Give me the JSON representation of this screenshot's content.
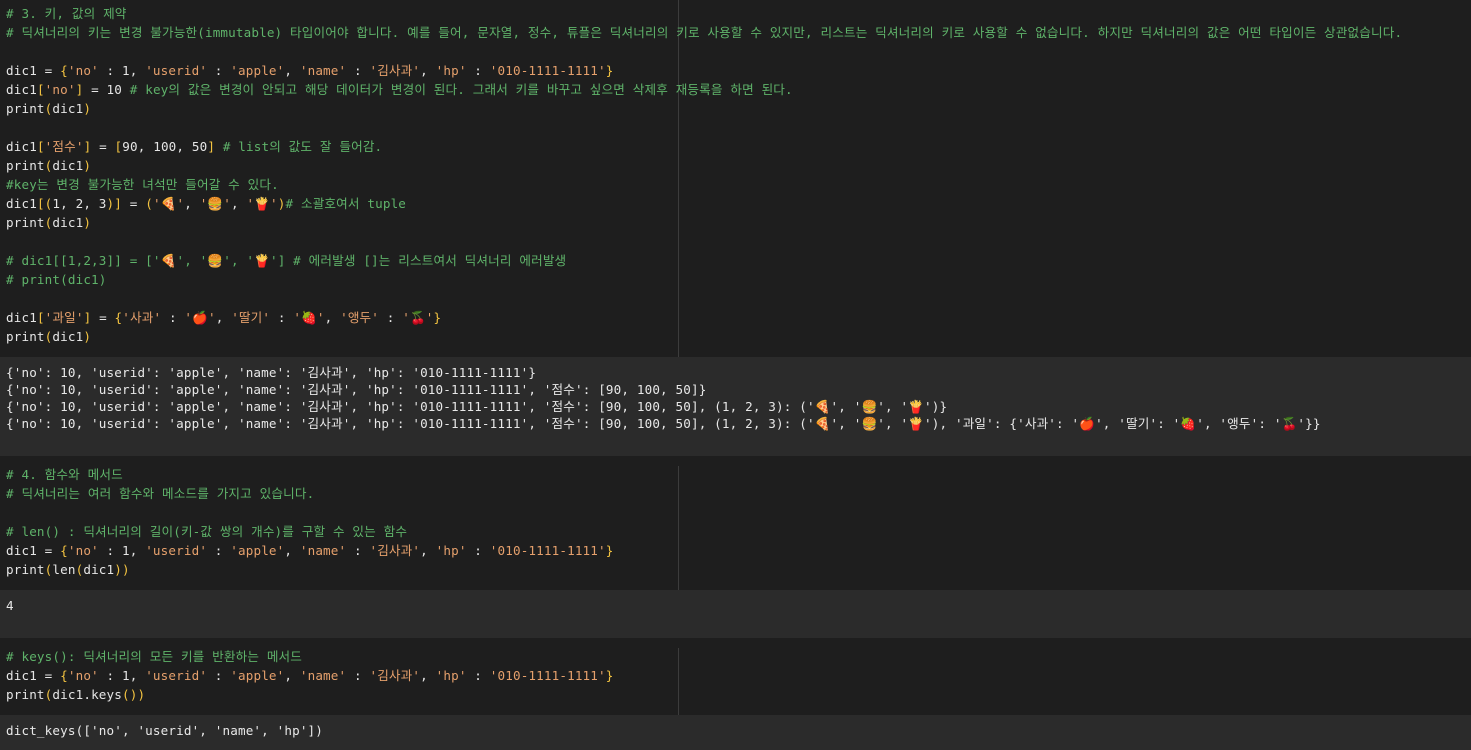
{
  "cells": [
    {
      "type": "code",
      "lines": [
        "# 3. 키, 값의 제약",
        "# 딕셔너리의 키는 변경 불가능한(immutable) 타입이어야 합니다. 예를 들어, 문자열, 정수, 튜플은 딕셔너리의 키로 사용할 수 있지만, 리스트는 딕셔너리의 키로 사용할 수 없습니다. 하지만 딕셔너리의 값은 어떤 타입이든 상관없습니다.",
        "",
        "dic1 = {'no' : 1, 'userid' : 'apple', 'name' : '김사과', 'hp' : '010-1111-1111'}",
        "dic1['no'] = 10 # key의 값은 변경이 안되고 해당 데이터가 변경이 된다. 그래서 키를 바꾸고 싶으면 삭제후 재등록을 하면 된다.",
        "print(dic1)",
        "",
        "dic1['점수'] = [90, 100, 50] # list의 값도 잘 들어감.",
        "print(dic1)",
        "#key는 변경 불가능한 녀석만 들어갈 수 있다.",
        "dic1[(1, 2, 3)] = ('🍕', '🍔', '🍟')# 소괄호여서 tuple",
        "print(dic1)",
        "",
        "# dic1[[1,2,3]] = ['🍕', '🍔', '🍟'] # 에러발생 []는 리스트여서 딕셔너리 에러발생",
        "# print(dic1)",
        "",
        "dic1['과일'] = {'사과' : '🍎', '딸기' : '🍓', '앵두' : '🍒'}",
        "print(dic1)"
      ]
    },
    {
      "type": "output",
      "lines": [
        "{'no': 10, 'userid': 'apple', 'name': '김사과', 'hp': '010-1111-1111'}",
        "{'no': 10, 'userid': 'apple', 'name': '김사과', 'hp': '010-1111-1111', '점수': [90, 100, 50]}",
        "{'no': 10, 'userid': 'apple', 'name': '김사과', 'hp': '010-1111-1111', '점수': [90, 100, 50], (1, 2, 3): ('🍕', '🍔', '🍟')}",
        "{'no': 10, 'userid': 'apple', 'name': '김사과', 'hp': '010-1111-1111', '점수': [90, 100, 50], (1, 2, 3): ('🍕', '🍔', '🍟'), '과일': {'사과': '🍎', '딸기': '🍓', '앵두': '🍒'}}"
      ]
    },
    {
      "type": "code",
      "lines": [
        "# 4. 함수와 메서드",
        "# 딕셔너리는 여러 함수와 메소드를 가지고 있습니다.",
        "",
        "# len() : 딕셔너리의 길이(키-값 쌍의 개수)를 구할 수 있는 함수",
        "dic1 = {'no' : 1, 'userid' : 'apple', 'name' : '김사과', 'hp' : '010-1111-1111'}",
        "print(len(dic1))"
      ]
    },
    {
      "type": "output",
      "lines": [
        "4"
      ]
    },
    {
      "type": "code",
      "lines": [
        "# keys(): 딕셔너리의 모든 키를 반환하는 메서드",
        "dic1 = {'no' : 1, 'userid' : 'apple', 'name' : '김사과', 'hp' : '010-1111-1111'}",
        "print(dic1.keys())"
      ]
    },
    {
      "type": "output",
      "lines": [
        "dict_keys(['no', 'userid', 'name', 'hp'])"
      ]
    }
  ]
}
